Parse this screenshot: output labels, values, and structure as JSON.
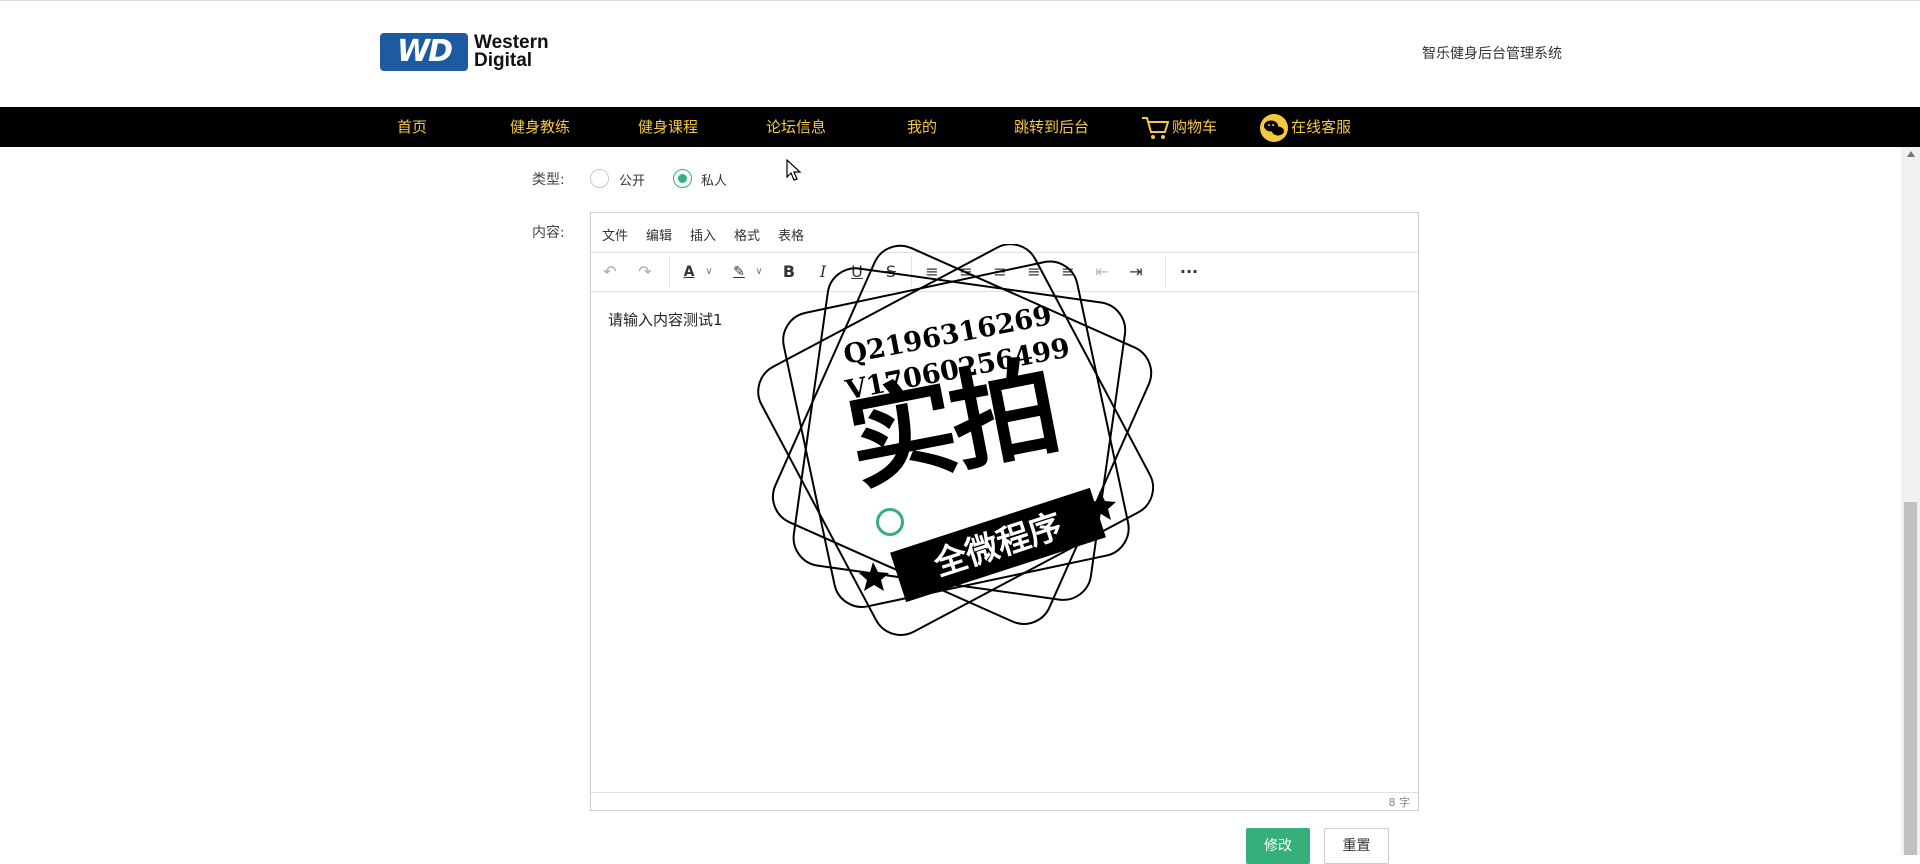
{
  "header": {
    "logo_mark": "WD",
    "logo_line1": "Western",
    "logo_line2": "Digital",
    "system_title": "智乐健身后台管理系统"
  },
  "nav": {
    "items": [
      {
        "label": "首页"
      },
      {
        "label": "健身教练"
      },
      {
        "label": "健身课程"
      },
      {
        "label": "论坛信息"
      },
      {
        "label": "我的"
      },
      {
        "label": "跳转到后台"
      },
      {
        "label": "购物车",
        "icon": "cart-icon"
      },
      {
        "label": "在线客服",
        "icon": "wechat-icon"
      }
    ],
    "colors": {
      "background": "#000000",
      "text": "#f5c842"
    }
  },
  "form": {
    "type_label": "类型:",
    "type_options": [
      {
        "label": "公开",
        "checked": false
      },
      {
        "label": "私人",
        "checked": true
      }
    ],
    "content_label": "内容:",
    "editor": {
      "menu": [
        "文件",
        "编辑",
        "插入",
        "格式",
        "表格"
      ],
      "toolbar_icons": [
        "undo-icon",
        "redo-icon",
        "text-color-icon",
        "highlight-icon",
        "bold-icon",
        "italic-icon",
        "underline-icon",
        "strikethrough-icon",
        "line-height-icon",
        "align-left-icon",
        "align-center-icon",
        "align-right-icon",
        "align-justify-icon",
        "outdent-icon",
        "indent-icon",
        "more-icon"
      ],
      "content": "请输入内容测试1",
      "word_count": "8 字"
    },
    "submit_label": "修改",
    "reset_label": "重置"
  },
  "watermark": {
    "line1": "Q2196316269",
    "line2": "V17060256499",
    "big": "实拍",
    "banner": "全微程序"
  },
  "accent_color": "#35b07c"
}
